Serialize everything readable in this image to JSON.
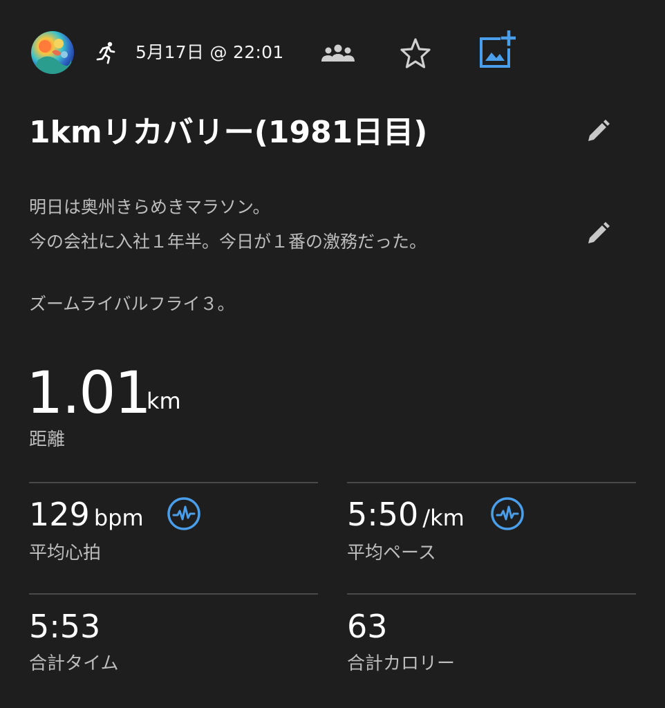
{
  "header": {
    "date": "5月17日 @ 22:01",
    "icons": [
      "avatar",
      "running-icon",
      "group-icon",
      "star-icon",
      "add-photo-icon"
    ]
  },
  "activity": {
    "title": "1kmリカバリー(1981日目)",
    "description_lines": [
      "明日は奥州きらめきマラソン。",
      "今の会社に入社１年半。今日が１番の激務だった。",
      "ズームライバルフライ３。"
    ]
  },
  "distance": {
    "value": "1.01",
    "unit": "km",
    "label": "距離"
  },
  "stats": [
    {
      "value": "129",
      "unit": "bpm",
      "label": "平均心拍",
      "icon": "heart-rate-chart-icon"
    },
    {
      "value": "5:50",
      "unit": "/km",
      "label": "平均ペース",
      "icon": "pace-chart-icon"
    },
    {
      "value": "5:53",
      "unit": "",
      "label": "合計タイム"
    },
    {
      "value": "63",
      "unit": "",
      "label": "合計カロリー"
    }
  ],
  "colors": {
    "background": "#1e1e1e",
    "accent_blue": "#4a9eea",
    "secondary_text": "#bdbdbd",
    "divider": "#4a4a4a"
  }
}
